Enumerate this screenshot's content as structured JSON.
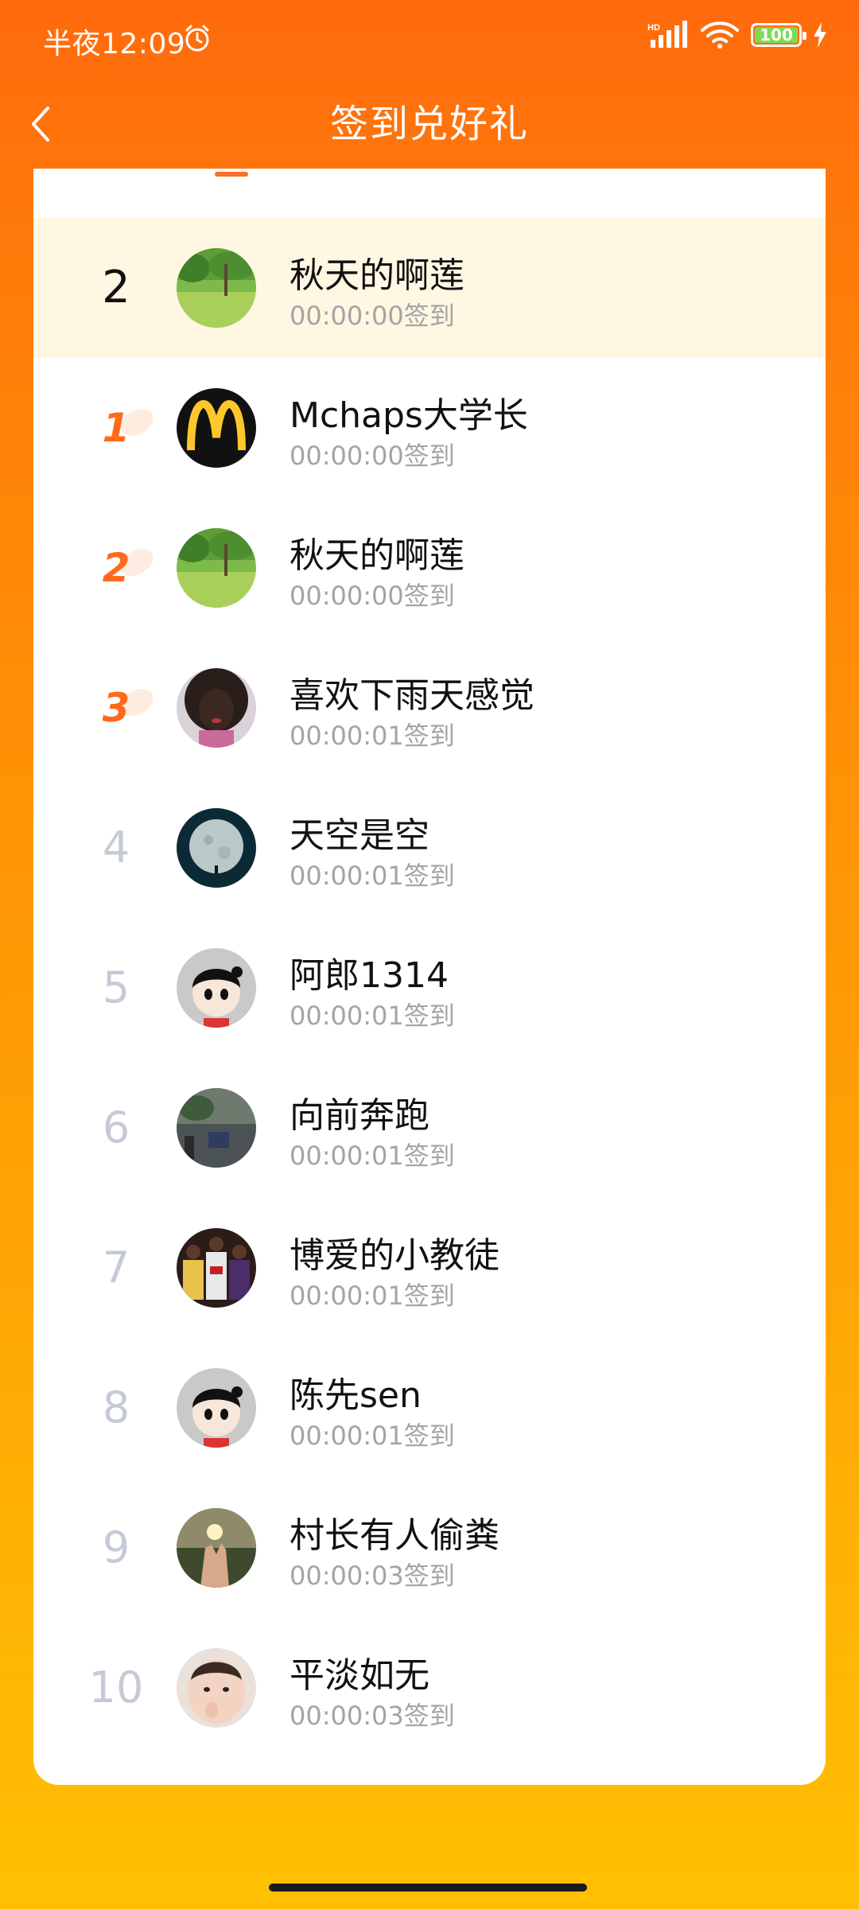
{
  "status_bar": {
    "time": "半夜12:09",
    "battery": "100"
  },
  "nav": {
    "title": "签到兑好礼"
  },
  "my_rank": {
    "rank": "2",
    "name": "秋天的啊莲",
    "time": "00:00:00签到",
    "avatar": "landscape-avatar"
  },
  "list": [
    {
      "rank": "1",
      "name": "Mchaps大学长",
      "time": "00:00:00签到",
      "avatar": "mcdonalds-logo-avatar"
    },
    {
      "rank": "2",
      "name": "秋天的啊莲",
      "time": "00:00:00签到",
      "avatar": "landscape-avatar"
    },
    {
      "rank": "3",
      "name": "喜欢下雨天感觉",
      "time": "00:00:01签到",
      "avatar": "child-portrait-avatar"
    },
    {
      "rank": "4",
      "name": "天空是空",
      "time": "00:00:01签到",
      "avatar": "moon-avatar"
    },
    {
      "rank": "5",
      "name": "阿郎1314",
      "time": "00:00:01签到",
      "avatar": "cartoon-kid-avatar"
    },
    {
      "rank": "6",
      "name": "向前奔跑",
      "time": "00:00:01签到",
      "avatar": "street-photo-avatar"
    },
    {
      "rank": "7",
      "name": "博爱的小教徒",
      "time": "00:00:01签到",
      "avatar": "basketball-players-avatar"
    },
    {
      "rank": "8",
      "name": "陈先sen",
      "time": "00:00:01签到",
      "avatar": "cartoon-kid-avatar"
    },
    {
      "rank": "9",
      "name": "村长有人偷粪",
      "time": "00:00:03签到",
      "avatar": "sunset-hand-avatar"
    },
    {
      "rank": "10",
      "name": "平淡如无",
      "time": "00:00:03签到",
      "avatar": "baby-avatar"
    }
  ],
  "colors": {
    "accent": "#FF6A1A",
    "highlight_row": "#FFF7E1",
    "muted_rank": "#C5CAD6",
    "time_text": "#A4A4A4"
  }
}
